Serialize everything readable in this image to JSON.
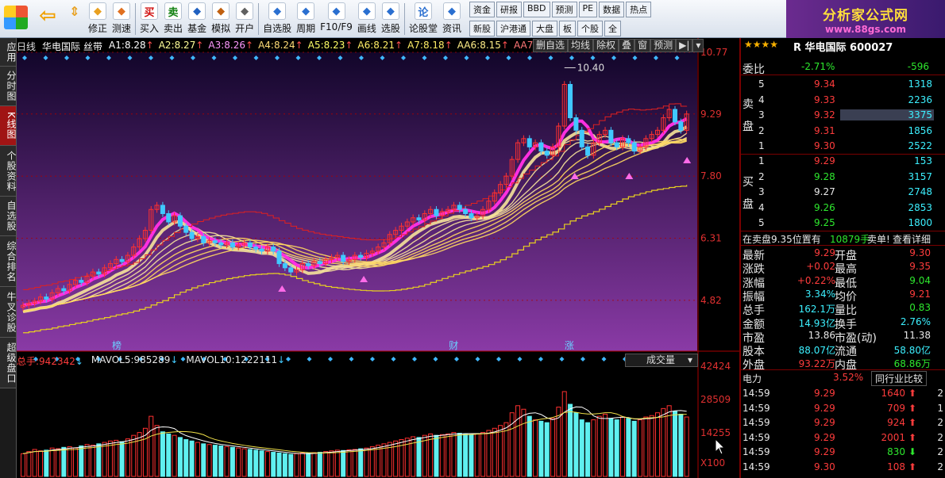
{
  "toolbar": {
    "items": [
      {
        "label": "修正",
        "icon": "revise-icon",
        "color": "#e8a020"
      },
      {
        "label": "测速",
        "icon": "speed-icon",
        "color": "#e07020"
      },
      {
        "label": "买入",
        "icon": "buy-icon",
        "glyph": "买",
        "color": "#d01010"
      },
      {
        "label": "卖出",
        "icon": "sell-icon",
        "glyph": "卖",
        "color": "#108010"
      },
      {
        "label": "基金",
        "icon": "fund-icon",
        "color": "#2060c0"
      },
      {
        "label": "模拟",
        "icon": "hammer-icon",
        "color": "#c06010"
      },
      {
        "label": "开户",
        "icon": "lock-icon",
        "color": "#606060"
      },
      {
        "label": "自选股",
        "icon": "star-icon",
        "color": "#2a6fd0"
      },
      {
        "label": "周期",
        "icon": "clock-icon",
        "color": "#2a6fd0"
      },
      {
        "label": "F10/F9",
        "icon": "f10-icon",
        "color": "#2a6fd0"
      },
      {
        "label": "画线",
        "icon": "pen-icon",
        "color": "#2a6fd0"
      },
      {
        "label": "选股",
        "icon": "screen-icon",
        "color": "#2a6fd0"
      },
      {
        "label": "论股堂",
        "icon": "forum-icon",
        "glyph": "论",
        "color": "#2a6fd0"
      },
      {
        "label": "资讯",
        "icon": "news-icon",
        "color": "#2a6fd0"
      }
    ],
    "mini": [
      "资金",
      "研报",
      "BBD",
      "预测",
      "PE",
      "数据",
      "热点",
      "新股",
      "沪港通",
      "大盘",
      "板",
      "个股",
      "全"
    ]
  },
  "logo": {
    "text": "分析家公式网",
    "url_text": "www.88gs.com"
  },
  "side_tabs": [
    "应用",
    "分时图",
    "K线图",
    "个股资料",
    "自选股",
    "综合排名",
    "牛叉诊股",
    "超级盘口"
  ],
  "side_active": 2,
  "info": {
    "period": "日线",
    "name": "华电国际",
    "indicator": "丝带",
    "levels": [
      {
        "k": "A1:",
        "v": "8.28"
      },
      {
        "k": "A2:",
        "v": "8.27"
      },
      {
        "k": "A3:",
        "v": "8.26"
      },
      {
        "k": "A4:",
        "v": "8.24"
      },
      {
        "k": "A5:",
        "v": "8.23"
      },
      {
        "k": "A6:",
        "v": "8.21"
      },
      {
        "k": "A7:",
        "v": "8.18"
      },
      {
        "k": "AA6:",
        "v": "8.15"
      },
      {
        "k": "AA7:",
        "v": "8.1"
      }
    ]
  },
  "period_tabs": [
    "删自选",
    "均线",
    "除权",
    "叠",
    "窗",
    "预测"
  ],
  "price_axis": [
    "10.77",
    "9.29",
    "7.80",
    "6.31",
    "4.82"
  ],
  "price_ylim": [
    3.6,
    10.77
  ],
  "peak_label": "10.40",
  "markers": [
    {
      "text": "榜",
      "x": 0.14
    },
    {
      "text": "财",
      "x": 0.635
    },
    {
      "text": "涨",
      "x": 0.805
    }
  ],
  "volume": {
    "total_label": "总手:",
    "total": "942342",
    "ma5_label": "MAVOL5:",
    "ma5": "985289",
    "ma10_label": "MAVOL10:",
    "ma10": "1222111",
    "axis": [
      "42424",
      "28509",
      "14255"
    ],
    "unit": "X100",
    "select": "成交量"
  },
  "chart_data": {
    "type": "candlestick",
    "ylim": [
      3.6,
      10.77
    ],
    "closes": [
      4.7,
      4.75,
      4.8,
      4.9,
      4.85,
      5.0,
      5.1,
      5.05,
      5.2,
      5.3,
      5.25,
      5.4,
      5.5,
      5.45,
      5.6,
      5.7,
      5.8,
      5.75,
      5.9,
      6.1,
      6.3,
      6.5,
      7.0,
      7.1,
      6.9,
      6.7,
      6.85,
      6.6,
      6.45,
      6.3,
      6.35,
      6.2,
      6.25,
      6.2,
      6.15,
      6.2,
      6.1,
      6.15,
      6.2,
      6.1,
      6.05,
      6.0,
      6.1,
      6.0,
      5.7,
      5.6,
      5.5,
      5.55,
      5.7,
      5.65,
      5.75,
      5.7,
      5.8,
      5.85,
      5.9,
      5.75,
      5.8,
      5.9,
      5.85,
      5.95,
      6.0,
      6.1,
      6.2,
      6.4,
      6.5,
      6.6,
      6.7,
      6.8,
      6.75,
      6.9,
      7.0,
      6.85,
      6.95,
      7.0,
      7.1,
      7.0,
      6.9,
      6.8,
      6.85,
      7.0,
      7.2,
      7.4,
      7.6,
      7.8,
      8.2,
      8.6,
      8.7,
      8.5,
      8.6,
      8.4,
      8.3,
      8.5,
      9.0,
      10.0,
      9.2,
      8.9,
      8.5,
      8.3,
      8.6,
      8.8,
      8.9,
      8.6,
      8.5,
      8.7,
      8.6,
      8.4,
      8.5,
      8.7,
      8.8,
      8.9,
      9.2,
      9.4,
      9.1,
      8.9,
      9.29
    ],
    "volumes": [
      120,
      150,
      180,
      160,
      170,
      200,
      190,
      210,
      220,
      200,
      230,
      250,
      240,
      260,
      280,
      300,
      310,
      290,
      330,
      380,
      420,
      480,
      650,
      520,
      430,
      400,
      380,
      350,
      320,
      300,
      280,
      260,
      250,
      240,
      230,
      220,
      210,
      200,
      190,
      180,
      170,
      160,
      150,
      140,
      130,
      120,
      110,
      120,
      130,
      125,
      135,
      140,
      150,
      160,
      170,
      165,
      175,
      180,
      190,
      200,
      220,
      240,
      260,
      280,
      300,
      320,
      340,
      360,
      350,
      380,
      400,
      380,
      390,
      400,
      420,
      410,
      400,
      390,
      400,
      420,
      450,
      480,
      520,
      560,
      700,
      800,
      750,
      650,
      600,
      580,
      560,
      620,
      780,
      1000,
      820,
      700,
      600,
      560,
      600,
      650,
      680,
      620,
      600,
      640,
      620,
      580,
      600,
      640,
      660,
      700,
      760,
      800,
      720,
      680,
      640
    ],
    "last_price": "9.29"
  },
  "panel": {
    "stock_code": "R 华电国际 600027",
    "weibi_label": "委比",
    "weibi": "-2.71%",
    "weicha": "-596",
    "sell_label": "卖盘",
    "buy_label": "买盘",
    "sells": [
      {
        "n": "5",
        "p": "9.34",
        "v": "1318"
      },
      {
        "n": "4",
        "p": "9.33",
        "v": "2236"
      },
      {
        "n": "3",
        "p": "9.32",
        "v": "3375"
      },
      {
        "n": "2",
        "p": "9.31",
        "v": "1856"
      },
      {
        "n": "1",
        "p": "9.30",
        "v": "2522"
      }
    ],
    "buys": [
      {
        "n": "1",
        "p": "9.29",
        "v": "153"
      },
      {
        "n": "2",
        "p": "9.28",
        "v": "3157"
      },
      {
        "n": "3",
        "p": "9.27",
        "v": "2748"
      },
      {
        "n": "4",
        "p": "9.26",
        "v": "2853"
      },
      {
        "n": "5",
        "p": "9.25",
        "v": "1800"
      }
    ],
    "notice": "在卖盘9.35位置有",
    "notice_vol": "10879手",
    "notice_act": "卖单!",
    "notice_link": "查看详细",
    "stats": [
      {
        "l1": "最新",
        "v1": "9.29",
        "c1": "red",
        "l2": "开盘",
        "v2": "9.30",
        "c2": "red"
      },
      {
        "l1": "涨跌",
        "v1": "+0.02",
        "c1": "red",
        "l2": "最高",
        "v2": "9.35",
        "c2": "red"
      },
      {
        "l1": "涨幅",
        "v1": "+0.22%",
        "c1": "red",
        "l2": "最低",
        "v2": "9.04",
        "c2": "grn"
      },
      {
        "l1": "振幅",
        "v1": "3.34%",
        "c1": "cyan",
        "l2": "均价",
        "v2": "9.21",
        "c2": "red"
      },
      {
        "l1": "总手",
        "v1": "162.1万",
        "c1": "cyan",
        "l2": "量比",
        "v2": "0.83",
        "c2": "grn"
      },
      {
        "l1": "金额",
        "v1": "14.93亿",
        "c1": "cyan",
        "l2": "换手",
        "v2": "2.76%",
        "c2": "cyan"
      },
      {
        "l1": "市盈",
        "v1": "13.86",
        "c1": "wht",
        "l2": "市盈(动)",
        "v2": "11.38",
        "c2": "wht"
      },
      {
        "l1": "股本",
        "v1": "88.07亿",
        "c1": "cyan",
        "l2": "流通",
        "v2": "58.80亿",
        "c2": "cyan"
      },
      {
        "l1": "外盘",
        "v1": "93.22万",
        "c1": "red",
        "l2": "内盘",
        "v2": "68.86万",
        "c2": "grn"
      }
    ],
    "sector": "电力",
    "sector_pct": "3.52%",
    "peer_btn": "同行业比较",
    "ticks": [
      {
        "t": "14:59",
        "p": "9.29",
        "v": "1640",
        "d": "up",
        "n": "2"
      },
      {
        "t": "14:59",
        "p": "9.29",
        "v": "709",
        "d": "up",
        "n": "1"
      },
      {
        "t": "14:59",
        "p": "9.29",
        "v": "924",
        "d": "up",
        "n": "2"
      },
      {
        "t": "14:59",
        "p": "9.29",
        "v": "2001",
        "d": "up",
        "n": "2"
      },
      {
        "t": "14:59",
        "p": "9.29",
        "v": "830",
        "d": "down",
        "n": "2"
      },
      {
        "t": "14:59",
        "p": "9.30",
        "v": "108",
        "d": "up",
        "n": "2"
      }
    ]
  }
}
